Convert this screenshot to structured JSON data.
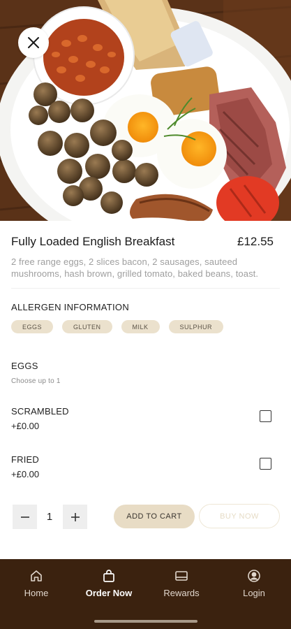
{
  "product": {
    "name": "Fully Loaded English Breakfast",
    "price": "£12.55",
    "description": "2 free range eggs, 2 slices bacon, 2 sausages, sauteed mushrooms, hash brown, grilled tomato, baked beans, toast."
  },
  "allergens": {
    "title": "ALLERGEN INFORMATION",
    "items": [
      "EGGS",
      "GLUTEN",
      "MILK",
      "SULPHUR"
    ]
  },
  "modifier_group": {
    "title": "EGGS",
    "caption": "Choose up to 1",
    "options": [
      {
        "name": "SCRAMBLED",
        "price": "+£0.00",
        "checked": false
      },
      {
        "name": "FRIED",
        "price": "+£0.00",
        "checked": false
      }
    ]
  },
  "cart": {
    "quantity": "1",
    "add_label": "ADD TO CART",
    "buy_label": "BUY NOW"
  },
  "nav": {
    "items": [
      {
        "label": "Home",
        "icon": "home-icon",
        "active": false
      },
      {
        "label": "Order Now",
        "icon": "bag-icon",
        "active": true
      },
      {
        "label": "Rewards",
        "icon": "card-icon",
        "active": false
      },
      {
        "label": "Login",
        "icon": "user-icon",
        "active": false
      }
    ]
  },
  "colors": {
    "nav_background": "#3b220f",
    "chip_background": "#ebe1cd",
    "add_button": "#e8dcc5",
    "accent_beige": "#e6dcc6"
  }
}
